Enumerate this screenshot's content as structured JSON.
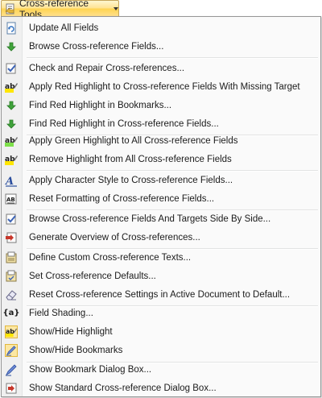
{
  "menu_button": {
    "label": "Cross-reference Tools",
    "icon": "cross-reference-tools-icon"
  },
  "items": [
    {
      "label": "Update All Fields",
      "icon": "update-fields-icon"
    },
    {
      "label": "Browse Cross-reference Fields...",
      "icon": "green-arrow-down-icon"
    },
    {
      "label": "Check and Repair Cross-references...",
      "icon": "check-repair-icon"
    },
    {
      "label": "Apply Red Highlight to Cross-reference Fields With Missing Target",
      "icon": "highlight-ab-icon"
    },
    {
      "label": "Find Red Highlight in Bookmarks...",
      "icon": "green-arrow-down-icon"
    },
    {
      "label": "Find Red Highlight in Cross-reference Fields...",
      "icon": "green-arrow-down-icon"
    },
    {
      "label": "Apply Green Highlight to All Cross-reference Fields",
      "icon": "highlight-ab-icon"
    },
    {
      "label": "Remove Highlight from All Cross-reference Fields",
      "icon": "highlight-ab-icon"
    },
    {
      "label": "Apply Character Style to Cross-reference Fields...",
      "icon": "character-style-icon"
    },
    {
      "label": "Reset Formatting of Cross-reference Fields...",
      "icon": "reset-formatting-icon"
    },
    {
      "label": "Browse Cross-reference Fields And Targets Side By Side...",
      "icon": "check-repair-icon"
    },
    {
      "label": "Generate Overview of Cross-references...",
      "icon": "generate-overview-icon"
    },
    {
      "label": "Define Custom Cross-reference Texts...",
      "icon": "define-texts-icon"
    },
    {
      "label": "Set Cross-reference Defaults...",
      "icon": "defaults-icon"
    },
    {
      "label": "Reset Cross-reference Settings in Active Document to Default...",
      "icon": "eraser-icon"
    },
    {
      "label": "Field Shading...",
      "icon": "field-shading-icon"
    },
    {
      "label": "Show/Hide Highlight",
      "icon": "highlight-ab-icon"
    },
    {
      "label": "Show/Hide Bookmarks",
      "icon": "bookmark-pen-icon"
    },
    {
      "label": "Show Bookmark Dialog Box...",
      "icon": "bookmark-pen-icon"
    },
    {
      "label": "Show Standard Cross-reference Dialog Box...",
      "icon": "standard-dialog-icon"
    }
  ],
  "glyphs": {
    "field_shading": "{a}",
    "ab": "ab",
    "style_a": "A",
    "reset_ab": "AB"
  }
}
